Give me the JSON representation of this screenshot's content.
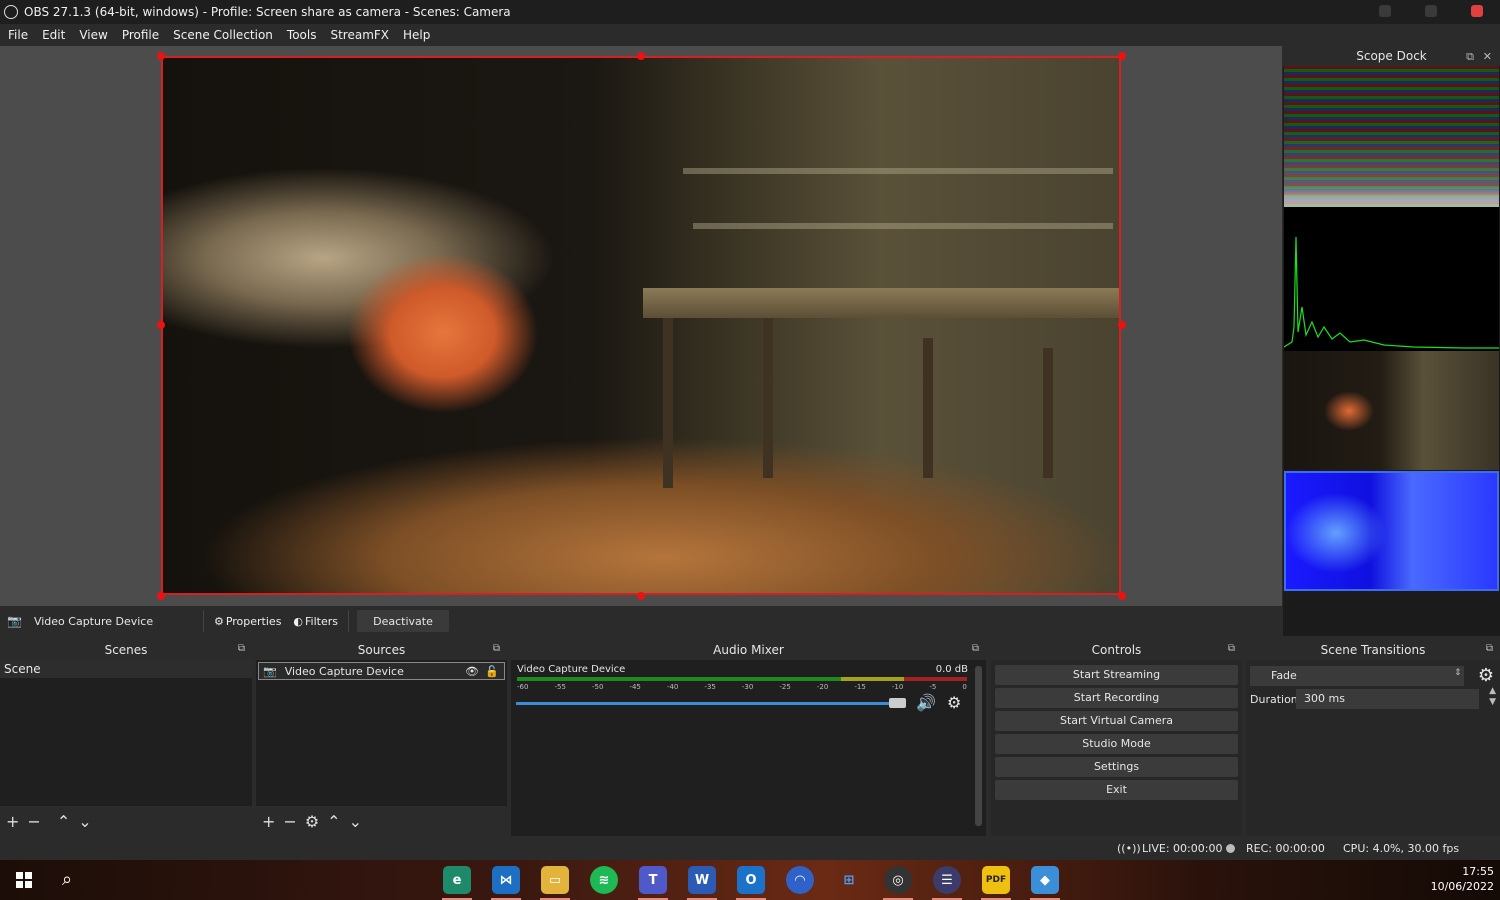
{
  "window": {
    "title": "OBS 27.1.3 (64-bit, windows) - Profile: Screen share as camera - Scenes: Camera"
  },
  "menu": [
    "File",
    "Edit",
    "View",
    "Profile",
    "Scene Collection",
    "Tools",
    "StreamFX",
    "Help"
  ],
  "scope_dock": {
    "title": "Scope Dock"
  },
  "source_toolbar": {
    "source_name": "Video Capture Device",
    "properties_label": "Properties",
    "filters_label": "Filters",
    "deactivate_label": "Deactivate"
  },
  "scenes": {
    "title": "Scenes",
    "items": [
      "Scene"
    ]
  },
  "sources": {
    "title": "Sources",
    "items": [
      "Video Capture Device"
    ]
  },
  "audio_mixer": {
    "title": "Audio Mixer",
    "channel": "Video Capture Device",
    "db": "0.0 dB",
    "ticks": [
      "-60",
      "-55",
      "-50",
      "-45",
      "-40",
      "-35",
      "-30",
      "-25",
      "-20",
      "-15",
      "-10",
      "-5",
      "0"
    ],
    "volume_level": 0.98
  },
  "controls": {
    "title": "Controls",
    "buttons": [
      "Start Streaming",
      "Start Recording",
      "Start Virtual Camera",
      "Studio Mode",
      "Settings",
      "Exit"
    ]
  },
  "scene_transitions": {
    "title": "Scene Transitions",
    "transition": "Fade",
    "duration_label": "Duration",
    "duration_value": "300 ms"
  },
  "status": {
    "live": "LIVE: 00:00:00",
    "rec": "REC: 00:00:00",
    "cpu": "CPU: 4.0%, 30.00 fps"
  },
  "taskbar": {
    "apps": [
      "edge-dev",
      "vscode",
      "file-explorer",
      "spotify",
      "teams",
      "word",
      "outlook",
      "app-blue",
      "network-app",
      "obs",
      "app-lines",
      "pdf",
      "app-shell"
    ],
    "time": "17:55",
    "date": "10/06/2022"
  },
  "colors": {
    "selection_red": "#d42020",
    "slider_blue": "#3b8ddb"
  }
}
